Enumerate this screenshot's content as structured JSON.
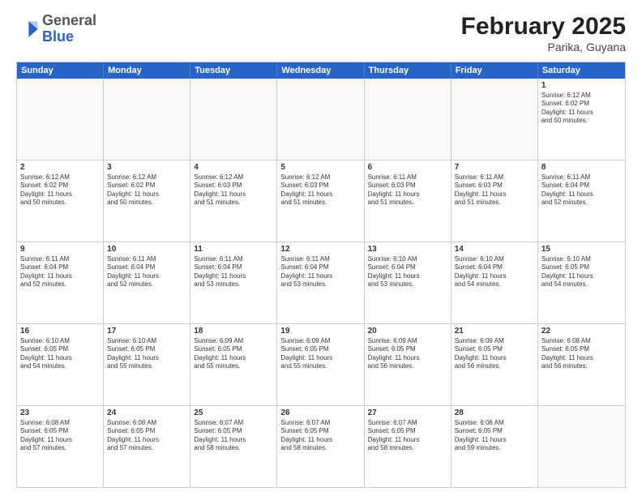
{
  "header": {
    "logo": {
      "general": "General",
      "blue": "Blue"
    },
    "title": "February 2025",
    "location": "Parika, Guyana"
  },
  "weekdays": [
    "Sunday",
    "Monday",
    "Tuesday",
    "Wednesday",
    "Thursday",
    "Friday",
    "Saturday"
  ],
  "weeks": [
    [
      {
        "day": "",
        "info": ""
      },
      {
        "day": "",
        "info": ""
      },
      {
        "day": "",
        "info": ""
      },
      {
        "day": "",
        "info": ""
      },
      {
        "day": "",
        "info": ""
      },
      {
        "day": "",
        "info": ""
      },
      {
        "day": "1",
        "info": "Sunrise: 6:12 AM\nSunset: 6:02 PM\nDaylight: 11 hours\nand 50 minutes."
      }
    ],
    [
      {
        "day": "2",
        "info": "Sunrise: 6:12 AM\nSunset: 6:02 PM\nDaylight: 11 hours\nand 50 minutes."
      },
      {
        "day": "3",
        "info": "Sunrise: 6:12 AM\nSunset: 6:02 PM\nDaylight: 11 hours\nand 50 minutes."
      },
      {
        "day": "4",
        "info": "Sunrise: 6:12 AM\nSunset: 6:03 PM\nDaylight: 11 hours\nand 51 minutes."
      },
      {
        "day": "5",
        "info": "Sunrise: 6:12 AM\nSunset: 6:03 PM\nDaylight: 11 hours\nand 51 minutes."
      },
      {
        "day": "6",
        "info": "Sunrise: 6:11 AM\nSunset: 6:03 PM\nDaylight: 11 hours\nand 51 minutes."
      },
      {
        "day": "7",
        "info": "Sunrise: 6:11 AM\nSunset: 6:03 PM\nDaylight: 11 hours\nand 51 minutes."
      },
      {
        "day": "8",
        "info": "Sunrise: 6:11 AM\nSunset: 6:04 PM\nDaylight: 11 hours\nand 52 minutes."
      }
    ],
    [
      {
        "day": "9",
        "info": "Sunrise: 6:11 AM\nSunset: 6:04 PM\nDaylight: 11 hours\nand 52 minutes."
      },
      {
        "day": "10",
        "info": "Sunrise: 6:11 AM\nSunset: 6:04 PM\nDaylight: 11 hours\nand 52 minutes."
      },
      {
        "day": "11",
        "info": "Sunrise: 6:11 AM\nSunset: 6:04 PM\nDaylight: 11 hours\nand 53 minutes."
      },
      {
        "day": "12",
        "info": "Sunrise: 6:11 AM\nSunset: 6:04 PM\nDaylight: 11 hours\nand 53 minutes."
      },
      {
        "day": "13",
        "info": "Sunrise: 6:10 AM\nSunset: 6:04 PM\nDaylight: 11 hours\nand 53 minutes."
      },
      {
        "day": "14",
        "info": "Sunrise: 6:10 AM\nSunset: 6:04 PM\nDaylight: 11 hours\nand 54 minutes."
      },
      {
        "day": "15",
        "info": "Sunrise: 6:10 AM\nSunset: 6:05 PM\nDaylight: 11 hours\nand 54 minutes."
      }
    ],
    [
      {
        "day": "16",
        "info": "Sunrise: 6:10 AM\nSunset: 6:05 PM\nDaylight: 11 hours\nand 54 minutes."
      },
      {
        "day": "17",
        "info": "Sunrise: 6:10 AM\nSunset: 6:05 PM\nDaylight: 11 hours\nand 55 minutes."
      },
      {
        "day": "18",
        "info": "Sunrise: 6:09 AM\nSunset: 6:05 PM\nDaylight: 11 hours\nand 55 minutes."
      },
      {
        "day": "19",
        "info": "Sunrise: 6:09 AM\nSunset: 6:05 PM\nDaylight: 11 hours\nand 55 minutes."
      },
      {
        "day": "20",
        "info": "Sunrise: 6:09 AM\nSunset: 6:05 PM\nDaylight: 11 hours\nand 56 minutes."
      },
      {
        "day": "21",
        "info": "Sunrise: 6:09 AM\nSunset: 6:05 PM\nDaylight: 11 hours\nand 56 minutes."
      },
      {
        "day": "22",
        "info": "Sunrise: 6:08 AM\nSunset: 6:05 PM\nDaylight: 11 hours\nand 56 minutes."
      }
    ],
    [
      {
        "day": "23",
        "info": "Sunrise: 6:08 AM\nSunset: 6:05 PM\nDaylight: 11 hours\nand 57 minutes."
      },
      {
        "day": "24",
        "info": "Sunrise: 6:08 AM\nSunset: 6:05 PM\nDaylight: 11 hours\nand 57 minutes."
      },
      {
        "day": "25",
        "info": "Sunrise: 6:07 AM\nSunset: 6:05 PM\nDaylight: 11 hours\nand 58 minutes."
      },
      {
        "day": "26",
        "info": "Sunrise: 6:07 AM\nSunset: 6:05 PM\nDaylight: 11 hours\nand 58 minutes."
      },
      {
        "day": "27",
        "info": "Sunrise: 6:07 AM\nSunset: 6:05 PM\nDaylight: 11 hours\nand 58 minutes."
      },
      {
        "day": "28",
        "info": "Sunrise: 6:06 AM\nSunset: 6:05 PM\nDaylight: 11 hours\nand 59 minutes."
      },
      {
        "day": "",
        "info": ""
      }
    ]
  ]
}
